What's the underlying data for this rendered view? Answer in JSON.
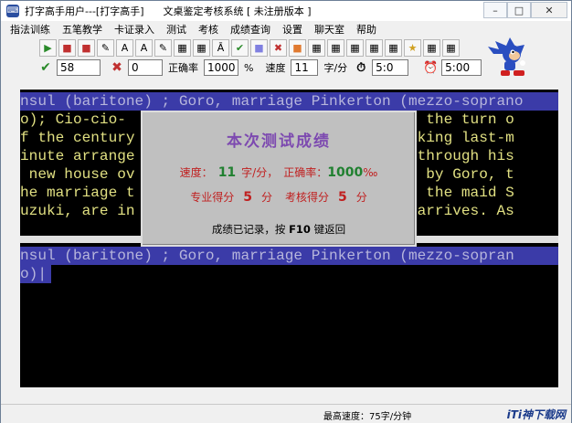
{
  "window": {
    "title": "打字高手用户---[打字高手]      文桌鉴定考核系统 [ 未注册版本 ]",
    "minimize": "–",
    "maximize": "□",
    "close": "✕"
  },
  "menu": [
    "指法训练",
    "五笔教学",
    "卡证录入",
    "测试",
    "考核",
    "成绩查询",
    "设置",
    "聊天室",
    "帮助"
  ],
  "toolbar": [
    "▶",
    "■",
    "■",
    "✎",
    "A",
    "A",
    "✎",
    "▦",
    "▦",
    "Ā",
    "✔",
    "■",
    "✖",
    "■",
    "▦",
    "▦",
    "▦",
    "▦",
    "▦",
    "★",
    "▦",
    "▦"
  ],
  "status": {
    "correct_icon": "✔",
    "correct_count": "58",
    "wrong_icon": "✖",
    "wrong_count": "0",
    "accuracy_label": "正确率",
    "accuracy_value": "1000",
    "percent": "%",
    "speed_label": "速度",
    "speed_value": "11",
    "speed_unit": "字/分",
    "elapsed_icon": "⏱",
    "elapsed": "5:0",
    "limit_icon": "⏰",
    "limit": "5:00"
  },
  "practice": {
    "lines": [
      "nsul (baritone) ; Goro, marriage Pinkerton (mezzo-soprano",
      "o); Cio-cio-                               at the turn o",
      "f the century                              Making last-m",
      "inute arrange                             vn through his",
      " new house ov                             aki by Goro, t",
      "he marriage t                             ing the maid S",
      "uzuki, are in                             ul,arrives. As"
    ],
    "typed_lines": [
      "nsul (baritone) ; Goro, marriage Pinkerton (mezzo-sopran",
      "o)|"
    ]
  },
  "dialog": {
    "title": "本次测试成绩",
    "speed_label": "速度：",
    "speed_value": "11",
    "speed_unit": "字/分，",
    "accuracy_label": "正确率：",
    "accuracy_value": "1000",
    "accuracy_unit": "‰",
    "pro_label": "专业得分",
    "pro_score": "5",
    "pro_unit": "分",
    "exam_label": "考核得分",
    "exam_score": "5",
    "exam_unit": "分",
    "footer_pre": "成绩已记录，按",
    "footer_key": "F10",
    "footer_post": "键返回"
  },
  "bottom": {
    "max_speed": "最高速度：75字/分钟",
    "watermark": "iTi神下载网"
  },
  "colors": {
    "panel_bg": "#000000",
    "text_yellow": "#e1e082",
    "highlight_bg": "#3b3ba8",
    "dialog_bg": "#c0c0c0",
    "dialog_title": "#7d4ab0"
  }
}
